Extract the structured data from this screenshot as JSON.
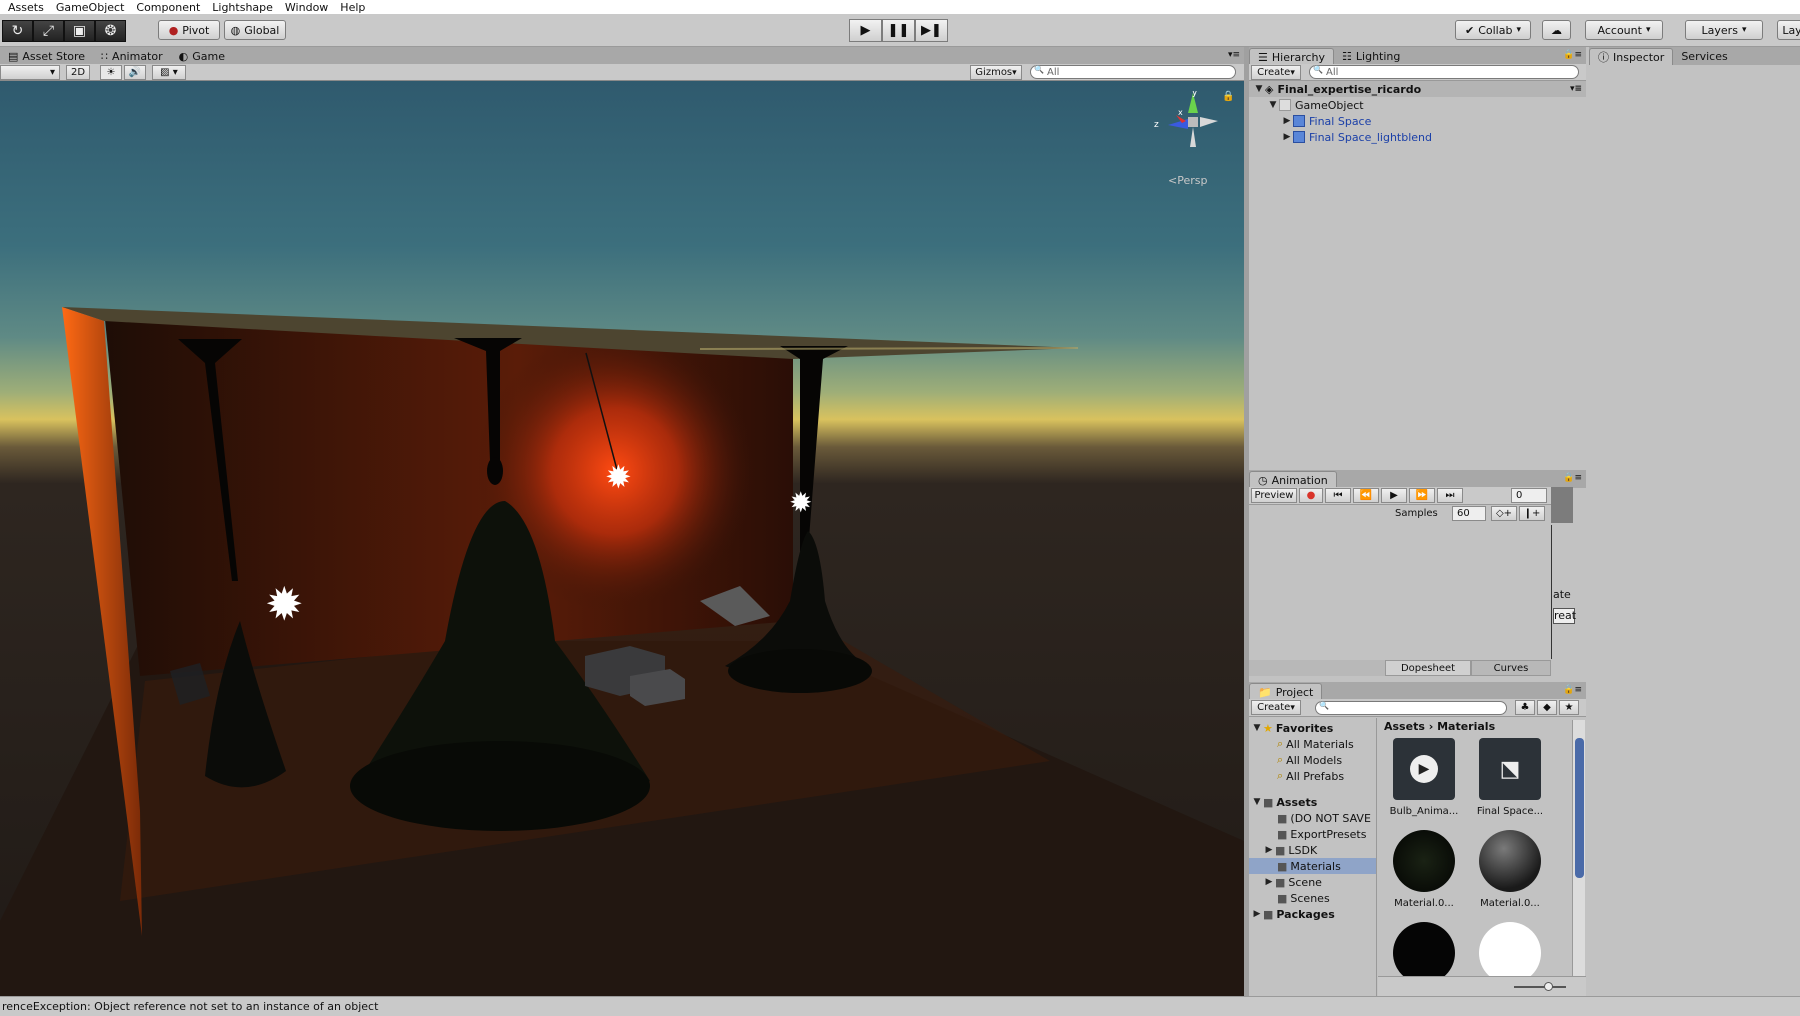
{
  "menu": [
    "Assets",
    "GameObject",
    "Component",
    "Lightshape",
    "Window",
    "Help"
  ],
  "toolbar": {
    "pivot": "Pivot",
    "global": "Global",
    "collab": "Collab",
    "account": "Account",
    "layers": "Layers",
    "layout": "Lay"
  },
  "scene_tabs": [
    "Asset Store",
    "Animator",
    "Game"
  ],
  "scene_toolbar": {
    "mode_2d": "2D",
    "gizmos": "Gizmos",
    "search_placeholder": "All",
    "persp": "Persp"
  },
  "hierarchy": {
    "tabs": [
      "Hierarchy",
      "Lighting"
    ],
    "create": "Create",
    "search_placeholder": "All",
    "scene": "Final_expertise_ricardo",
    "items": [
      {
        "label": "GameObject",
        "depth": 1,
        "expanded": true,
        "prefab": false
      },
      {
        "label": "Final Space",
        "depth": 2,
        "expanded": false,
        "prefab": true
      },
      {
        "label": "Final Space_lightblend",
        "depth": 2,
        "expanded": false,
        "prefab": true
      }
    ]
  },
  "animation": {
    "tab": "Animation",
    "preview": "Preview",
    "frame": "0",
    "samples_label": "Samples",
    "samples_value": "60",
    "bottom_tabs": [
      "Dopesheet",
      "Curves"
    ],
    "side_labels": [
      "ate",
      "reat"
    ]
  },
  "project": {
    "tab": "Project",
    "create": "Create",
    "breadcrumb": [
      "Assets",
      "Materials"
    ],
    "favorites_label": "Favorites",
    "favorites": [
      "All Materials",
      "All Models",
      "All Prefabs"
    ],
    "assets_label": "Assets",
    "folders": [
      {
        "label": "(DO NOT SAVE",
        "has_children": false,
        "selected": false
      },
      {
        "label": "ExportPresets",
        "has_children": false,
        "selected": false
      },
      {
        "label": "LSDK",
        "has_children": true,
        "selected": false
      },
      {
        "label": "Materials",
        "has_children": false,
        "selected": true
      },
      {
        "label": "Scene",
        "has_children": true,
        "selected": false
      },
      {
        "label": "Scenes",
        "has_children": false,
        "selected": false
      }
    ],
    "packages_label": "Packages",
    "assets": [
      {
        "label": "Bulb_Anima...",
        "kind": "animation"
      },
      {
        "label": "Final Space...",
        "kind": "controller"
      },
      {
        "label": "Material.0...",
        "kind": "material-dark"
      },
      {
        "label": "Material.0...",
        "kind": "material-grey"
      },
      {
        "label": "",
        "kind": "material-black"
      },
      {
        "label": "",
        "kind": "material-white"
      }
    ]
  },
  "inspector": {
    "tabs": [
      "Inspector",
      "Services"
    ]
  },
  "status": "renceException: Object reference not set to an instance of an object",
  "colors": {
    "accent_red": "#d9342a",
    "selection": "#8fa4c8",
    "prefab_blue": "#1a3fa8"
  }
}
